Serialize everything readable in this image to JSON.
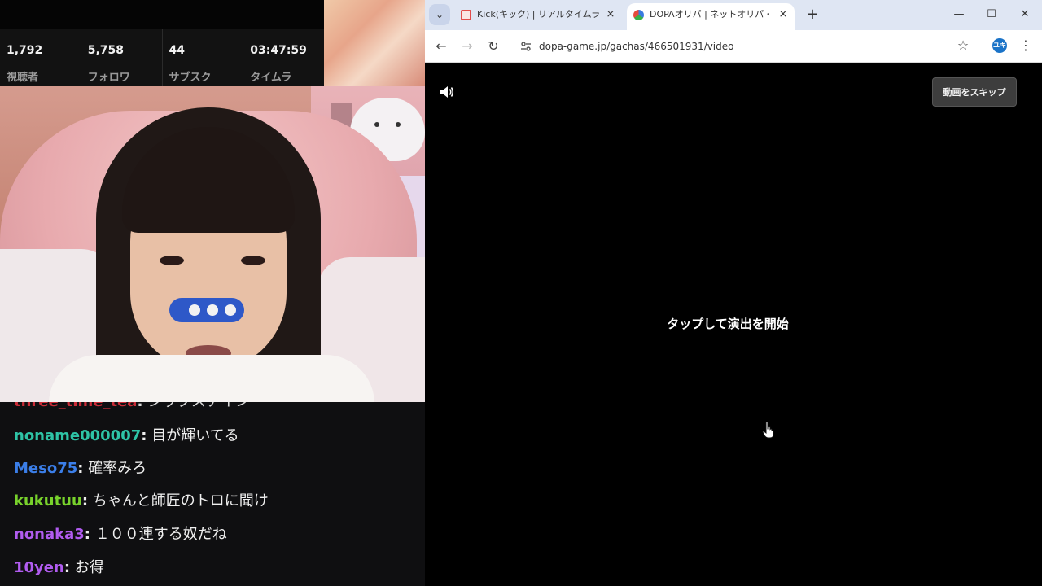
{
  "stream_stats": [
    {
      "value": "1,792",
      "label": "視聴者"
    },
    {
      "value": "5,758",
      "label": "フォロワ"
    },
    {
      "value": "44",
      "label": "サブスク"
    },
    {
      "value": "03:47:59",
      "label": "タイムラ"
    }
  ],
  "chat": {
    "partial_top": {
      "user": "three_time_tea",
      "message": "シックスナイン"
    },
    "messages": [
      {
        "user": "noname000007",
        "message": "目が輝いてる",
        "color": "#2ec4a6"
      },
      {
        "user": "Meso75",
        "message": "確率みろ",
        "color": "#3b7ee8"
      },
      {
        "user": "kukutuu",
        "message": "ちゃんと師匠のトロに聞け",
        "color": "#78d22c"
      },
      {
        "user": "nonaka3",
        "message": "１００連する奴だね",
        "color": "#b15cf0"
      },
      {
        "user": "10yen",
        "message": "お得",
        "color": "#b15cf0"
      }
    ],
    "separator": ":"
  },
  "browser": {
    "tabs": [
      {
        "title": "Kick(キック) | リアルタイムランキング",
        "favicon": "kick-favicon",
        "active": false
      },
      {
        "title": "DOPAオリパ | ネットオリパ・オンライ",
        "favicon": "dopa-favicon",
        "active": true
      }
    ],
    "new_tab_icon": "+",
    "close_icon": "×",
    "url": "dopa-game.jp/gachas/466501931/video",
    "avatar_initials": "ユキ",
    "window": {
      "minimize": "—",
      "maximize": "☐",
      "close": "✕"
    }
  },
  "page": {
    "skip_button": "動画をスキップ",
    "tap_prompt": "タップして演出を開始"
  }
}
